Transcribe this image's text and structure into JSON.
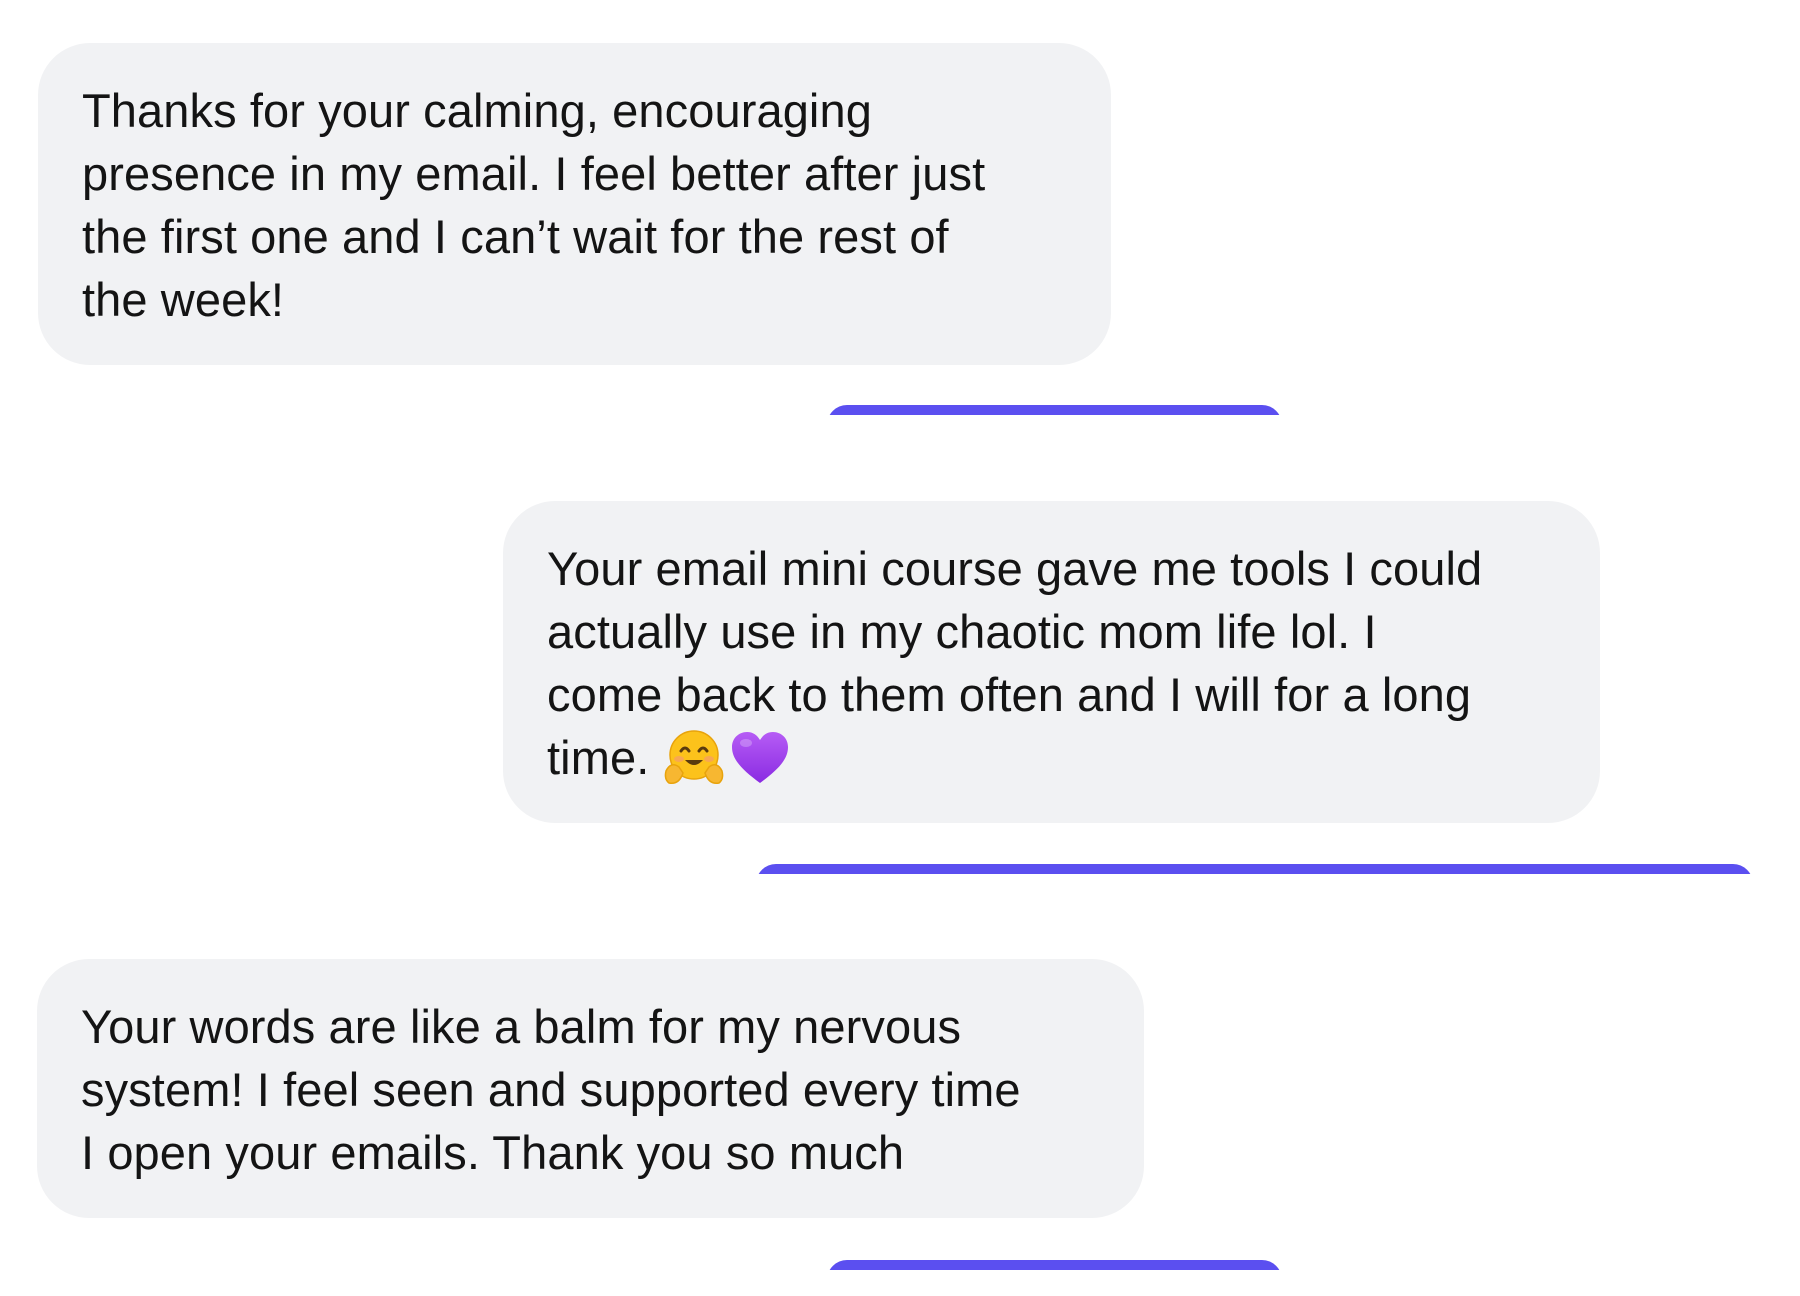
{
  "colors": {
    "bubble_background": "#f1f2f4",
    "text": "#141414",
    "accent_bar": "#5b4ff0",
    "page_background": "#ffffff"
  },
  "messages": [
    {
      "text": "Thanks for your calming, encouraging\npresence in my email. I feel better after just\nthe first one and I can’t wait for the rest of\nthe week!"
    },
    {
      "text": "Your email mini course gave me tools I could\nactually use in my chaotic mom life lol. I\ncome back to them often and I will for a long\ntime. ",
      "emojis": [
        "hugging-face-emoji",
        "purple-heart-emoji"
      ]
    },
    {
      "text": "Your words are like a balm for my nervous\nsystem! I feel seen and supported every time\nI open your emails. Thank you so much"
    }
  ]
}
